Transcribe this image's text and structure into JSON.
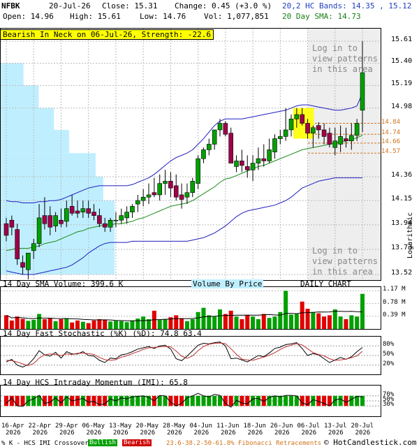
{
  "header": {
    "symbol": "NFBK",
    "date": "20-Jul-26",
    "close_text": "Close: 15.31",
    "change_text": "Change: 0.45 (+3.0 %)",
    "open_text": "Open: 14.96",
    "high_text": "High: 15.61",
    "low_text": "Low: 14.76",
    "vol_text": "Vol: 1,077,851",
    "bands_text": "20,2 HC Bands: 14.35 , 15.12",
    "sma_text": "20 Day SMA: 14.73"
  },
  "alert": {
    "text": "Bearish In Neck on 06-Jul-26, Strength: -22.6"
  },
  "pattern_note": {
    "line1": "Log in to",
    "line2": "view patterns",
    "line3": "in this area"
  },
  "price_axis": {
    "ticks": [
      "15.61",
      "15.40",
      "15.19",
      "14.98",
      "14.36",
      "14.15",
      "13.94",
      "13.73",
      "13.52"
    ],
    "scale_label": "Logarithmic"
  },
  "fib_levels": [
    "14.84",
    "14.74",
    "14.66",
    "14.57"
  ],
  "volume_panel": {
    "title": "14 Day SMA Volume: 399.6 K",
    "vbp_label": "Volume By Price",
    "daily_label": "DAILY CHART",
    "ticks": [
      "1.17 M",
      "0.78 M",
      "0.39 M"
    ]
  },
  "stoch_panel": {
    "title": "14 Day Fast Stochastic (%K) (%D): 74.8  63.4",
    "ticks": [
      "80%",
      "50%",
      "20%"
    ]
  },
  "momentum_panel": {
    "title": "14 Day HCS Intraday Momentum (IMI): 65.8",
    "ticks": [
      "70%",
      "50%",
      "30%"
    ]
  },
  "x_axis": {
    "labels": [
      {
        "d": "16-Apr",
        "y": "2026"
      },
      {
        "d": "22-Apr",
        "y": "2026"
      },
      {
        "d": "29-Apr",
        "y": "2026"
      },
      {
        "d": "06-May",
        "y": "2026"
      },
      {
        "d": "13-May",
        "y": "2026"
      },
      {
        "d": "20-May",
        "y": "2026"
      },
      {
        "d": "28-May",
        "y": "2026"
      },
      {
        "d": "04-Jun",
        "y": "2026"
      },
      {
        "d": "11-Jun",
        "y": "2026"
      },
      {
        "d": "18-Jun",
        "y": "2026"
      },
      {
        "d": "26-Jun",
        "y": "2026"
      },
      {
        "d": "06-Jul",
        "y": "2026"
      },
      {
        "d": "13-Jul",
        "y": "2026"
      },
      {
        "d": "20-Jul",
        "y": "2026"
      }
    ]
  },
  "footer": {
    "legend_prefix": "% K - HCS IMI Crossover:",
    "bullish": "Bullish",
    "bearish": "Bearish",
    "fib_text": "23.6-38.2-50-61.8% Fibonacci Retracements",
    "copyright": "© HotCandlestick.com"
  },
  "colors": {
    "bull": "#00a000",
    "bear": "#a0004a",
    "band": "#1f1fbf",
    "sma": "#1a8a1a",
    "vbp": "#bfefff",
    "volume_green": "#00a000",
    "volume_red": "#e00000"
  },
  "chart_data": {
    "type": "candlestick",
    "title": "",
    "ylabel": "Logarithmic",
    "ylim": [
      13.52,
      15.61
    ],
    "dates": [
      "16-Apr",
      "17-Apr",
      "20-Apr",
      "21-Apr",
      "22-Apr",
      "23-Apr",
      "24-Apr",
      "27-Apr",
      "28-Apr",
      "29-Apr",
      "30-Apr",
      "01-May",
      "04-May",
      "05-May",
      "06-May",
      "07-May",
      "08-May",
      "11-May",
      "12-May",
      "13-May",
      "14-May",
      "15-May",
      "18-May",
      "19-May",
      "20-May",
      "21-May",
      "22-May",
      "26-May",
      "27-May",
      "28-May",
      "29-May",
      "01-Jun",
      "02-Jun",
      "03-Jun",
      "04-Jun",
      "05-Jun",
      "08-Jun",
      "09-Jun",
      "10-Jun",
      "11-Jun",
      "12-Jun",
      "15-Jun",
      "16-Jun",
      "17-Jun",
      "18-Jun",
      "19-Jun",
      "22-Jun",
      "23-Jun",
      "24-Jun",
      "25-Jun",
      "26-Jun",
      "29-Jun",
      "30-Jun",
      "01-Jul",
      "02-Jul",
      "06-Jul",
      "07-Jul",
      "08-Jul",
      "09-Jul",
      "10-Jul",
      "13-Jul",
      "14-Jul",
      "15-Jul",
      "16-Jul",
      "17-Jul",
      "20-Jul"
    ],
    "open": [
      13.95,
      13.98,
      13.9,
      13.62,
      13.56,
      13.72,
      13.78,
      14.02,
      14.02,
      13.93,
      13.98,
      13.97,
      14.1,
      14.06,
      14.05,
      14.08,
      14.05,
      14.02,
      13.95,
      13.92,
      13.98,
      13.98,
      14.0,
      14.05,
      14.12,
      14.15,
      14.18,
      14.22,
      14.2,
      14.3,
      14.32,
      14.28,
      14.2,
      14.18,
      14.22,
      14.3,
      14.52,
      14.6,
      14.65,
      14.78,
      14.84,
      14.75,
      14.45,
      14.5,
      14.45,
      14.42,
      14.48,
      14.52,
      14.5,
      14.58,
      14.7,
      14.72,
      14.78,
      14.88,
      14.92,
      14.84,
      14.75,
      14.82,
      14.78,
      14.75,
      14.62,
      14.65,
      14.7,
      14.68,
      14.73,
      14.96
    ],
    "high": [
      14.0,
      14.02,
      13.95,
      13.68,
      13.6,
      13.82,
      14.12,
      14.18,
      14.1,
      14.05,
      14.08,
      14.15,
      14.2,
      14.15,
      14.15,
      14.15,
      14.12,
      14.08,
      14.0,
      14.0,
      14.05,
      14.08,
      14.1,
      14.12,
      14.2,
      14.25,
      14.3,
      14.35,
      14.38,
      14.42,
      14.4,
      14.38,
      14.3,
      14.3,
      14.35,
      14.55,
      14.62,
      14.7,
      14.78,
      14.88,
      14.86,
      14.8,
      14.55,
      14.6,
      14.55,
      14.55,
      14.62,
      14.65,
      14.7,
      14.74,
      14.78,
      14.98,
      14.92,
      14.98,
      14.98,
      14.88,
      14.82,
      14.85,
      14.84,
      14.8,
      14.8,
      14.82,
      14.8,
      14.84,
      14.88,
      15.61
    ],
    "low": [
      13.8,
      13.85,
      13.6,
      13.52,
      13.48,
      13.65,
      13.75,
      13.9,
      13.85,
      13.88,
      13.92,
      13.92,
      14.02,
      14.0,
      14.0,
      14.0,
      13.98,
      13.92,
      13.88,
      13.88,
      13.92,
      13.95,
      13.95,
      14.0,
      14.05,
      14.1,
      14.12,
      14.18,
      14.15,
      14.2,
      14.18,
      14.15,
      14.08,
      14.12,
      14.18,
      14.25,
      14.48,
      14.55,
      14.6,
      14.72,
      14.72,
      14.5,
      14.4,
      14.4,
      14.35,
      14.32,
      14.42,
      14.45,
      14.48,
      14.52,
      14.65,
      14.68,
      14.72,
      14.8,
      14.82,
      14.7,
      14.62,
      14.7,
      14.65,
      14.62,
      14.55,
      14.58,
      14.62,
      14.6,
      14.68,
      14.76
    ],
    "close": [
      13.85,
      13.92,
      13.65,
      13.58,
      13.7,
      13.78,
      14.0,
      13.95,
      13.92,
      14.02,
      13.95,
      14.08,
      14.04,
      14.04,
      14.08,
      14.04,
      14.02,
      13.95,
      13.92,
      13.98,
      13.98,
      14.02,
      14.05,
      14.1,
      14.15,
      14.18,
      14.2,
      14.2,
      14.3,
      14.32,
      14.26,
      14.18,
      14.16,
      14.22,
      14.32,
      14.52,
      14.6,
      14.65,
      14.78,
      14.84,
      14.74,
      14.48,
      14.5,
      14.46,
      14.42,
      14.48,
      14.52,
      14.5,
      14.6,
      14.7,
      14.72,
      14.78,
      14.88,
      14.92,
      14.84,
      14.75,
      14.8,
      14.78,
      14.72,
      14.65,
      14.68,
      14.72,
      14.68,
      14.73,
      14.84,
      15.31
    ],
    "sma20": [
      13.72,
      13.73,
      13.74,
      13.74,
      13.74,
      13.75,
      13.76,
      13.78,
      13.79,
      13.8,
      13.82,
      13.84,
      13.86,
      13.88,
      13.89,
      13.91,
      13.92,
      13.93,
      13.94,
      13.94,
      13.95,
      13.95,
      13.96,
      13.97,
      13.99,
      14.0,
      14.02,
      14.04,
      14.06,
      14.08,
      14.1,
      14.11,
      14.12,
      14.13,
      14.15,
      14.18,
      14.21,
      14.24,
      14.27,
      14.31,
      14.34,
      14.35,
      14.37,
      14.39,
      14.41,
      14.43,
      14.45,
      14.46,
      14.48,
      14.5,
      14.52,
      14.54,
      14.56,
      14.58,
      14.6,
      14.61,
      14.62,
      14.63,
      14.64,
      14.65,
      14.66,
      14.67,
      14.68,
      14.69,
      14.71,
      14.73
    ],
    "band_upper": [
      14.15,
      14.14,
      14.14,
      14.13,
      14.13,
      14.13,
      14.14,
      14.14,
      14.15,
      14.15,
      14.16,
      14.18,
      14.2,
      14.22,
      14.24,
      14.26,
      14.27,
      14.28,
      14.28,
      14.28,
      14.28,
      14.28,
      14.28,
      14.29,
      14.31,
      14.33,
      14.35,
      14.38,
      14.42,
      14.46,
      14.5,
      14.53,
      14.55,
      14.57,
      14.6,
      14.65,
      14.7,
      14.76,
      14.82,
      14.86,
      14.88,
      14.88,
      14.88,
      14.88,
      14.89,
      14.9,
      14.91,
      14.92,
      14.93,
      14.94,
      14.95,
      14.96,
      14.98,
      15.0,
      15.01,
      15.01,
      15.0,
      14.99,
      14.98,
      14.97,
      14.96,
      14.96,
      14.97,
      14.98,
      15.0,
      15.12
    ],
    "band_lower": [
      13.55,
      13.54,
      13.53,
      13.52,
      13.52,
      13.52,
      13.53,
      13.54,
      13.55,
      13.56,
      13.57,
      13.58,
      13.6,
      13.63,
      13.66,
      13.7,
      13.73,
      13.76,
      13.78,
      13.79,
      13.79,
      13.79,
      13.79,
      13.8,
      13.8,
      13.8,
      13.8,
      13.8,
      13.8,
      13.8,
      13.8,
      13.8,
      13.8,
      13.8,
      13.81,
      13.82,
      13.83,
      13.85,
      13.87,
      13.9,
      13.93,
      13.97,
      14.01,
      14.04,
      14.06,
      14.07,
      14.08,
      14.09,
      14.1,
      14.11,
      14.13,
      14.15,
      14.18,
      14.22,
      14.26,
      14.28,
      14.3,
      14.32,
      14.33,
      14.34,
      14.35,
      14.35,
      14.35,
      14.35,
      14.35,
      14.35
    ],
    "volume_k": [
      420,
      260,
      380,
      310,
      250,
      280,
      460,
      300,
      320,
      240,
      300,
      330,
      200,
      260,
      220,
      180,
      260,
      300,
      280,
      230,
      250,
      240,
      210,
      260,
      320,
      380,
      300,
      560,
      280,
      300,
      360,
      420,
      330,
      240,
      300,
      520,
      650,
      420,
      380,
      600,
      460,
      560,
      380,
      300,
      420,
      380,
      300,
      460,
      340,
      380,
      520,
      1170,
      440,
      460,
      840,
      620,
      520,
      480,
      380,
      420,
      600,
      380,
      300,
      420,
      380,
      1077
    ],
    "stoch_k": [
      30,
      38,
      20,
      14,
      22,
      40,
      65,
      52,
      48,
      60,
      42,
      62,
      55,
      55,
      62,
      50,
      48,
      35,
      28,
      42,
      40,
      52,
      55,
      62,
      70,
      74,
      78,
      72,
      80,
      82,
      70,
      40,
      34,
      48,
      65,
      82,
      88,
      86,
      90,
      92,
      80,
      40,
      42,
      36,
      30,
      40,
      50,
      46,
      58,
      72,
      76,
      84,
      86,
      90,
      72,
      50,
      56,
      52,
      40,
      28,
      36,
      44,
      38,
      46,
      62,
      75
    ],
    "stoch_d": [
      35,
      34,
      30,
      24,
      19,
      25,
      42,
      52,
      55,
      53,
      50,
      55,
      53,
      57,
      57,
      56,
      53,
      44,
      37,
      35,
      37,
      45,
      49,
      56,
      62,
      69,
      74,
      75,
      77,
      78,
      77,
      64,
      48,
      41,
      49,
      65,
      78,
      85,
      88,
      89,
      87,
      71,
      54,
      39,
      36,
      35,
      40,
      45,
      51,
      59,
      69,
      77,
      82,
      87,
      83,
      71,
      59,
      53,
      49,
      40,
      35,
      36,
      39,
      43,
      49,
      63
    ],
    "imi": [
      40,
      62,
      30,
      28,
      50,
      58,
      72,
      40,
      45,
      62,
      42,
      66,
      50,
      55,
      60,
      45,
      48,
      35,
      38,
      58,
      50,
      62,
      58,
      66,
      68,
      70,
      64,
      50,
      72,
      70,
      45,
      30,
      40,
      62,
      70,
      80,
      70,
      66,
      76,
      72,
      40,
      25,
      52,
      42,
      38,
      58,
      60,
      48,
      64,
      70,
      66,
      72,
      72,
      70,
      42,
      35,
      55,
      48,
      40,
      30,
      54,
      58,
      44,
      56,
      68,
      66
    ]
  }
}
